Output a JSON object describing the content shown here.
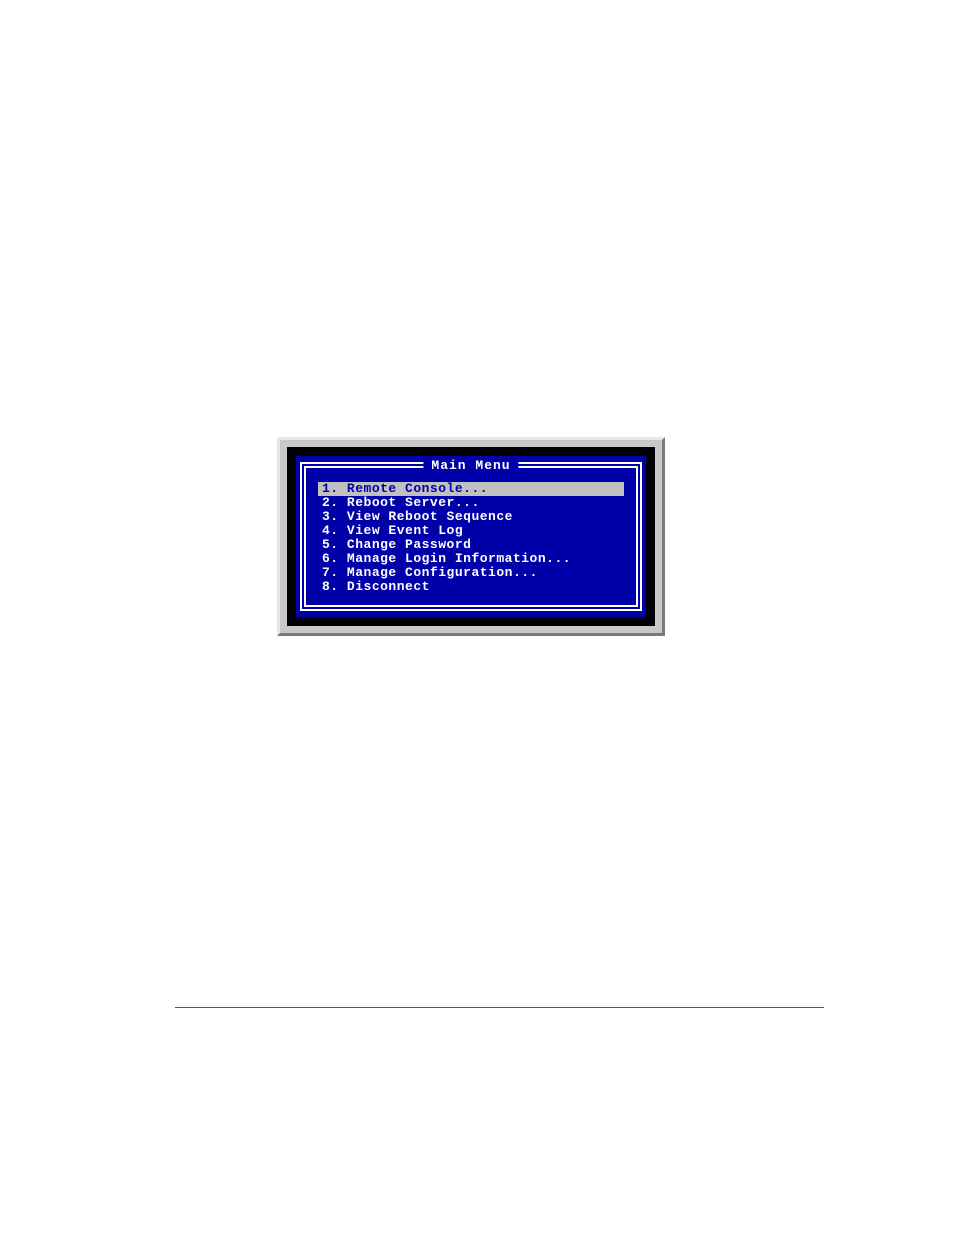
{
  "terminal": {
    "title": "Main Menu",
    "selected_index": 0,
    "items": [
      {
        "num": "1.",
        "label": "Remote Console..."
      },
      {
        "num": "2.",
        "label": "Reboot Server..."
      },
      {
        "num": "3.",
        "label": "View Reboot Sequence"
      },
      {
        "num": "4.",
        "label": "View Event Log"
      },
      {
        "num": "5.",
        "label": "Change Password"
      },
      {
        "num": "6.",
        "label": "Manage Login Information..."
      },
      {
        "num": "7.",
        "label": "Manage Configuration..."
      },
      {
        "num": "8.",
        "label": "Disconnect"
      }
    ]
  },
  "colors": {
    "blue": "#0000a8",
    "gray_bezel": "#c8c8c8",
    "highlight_bg": "#c0c0c0"
  }
}
